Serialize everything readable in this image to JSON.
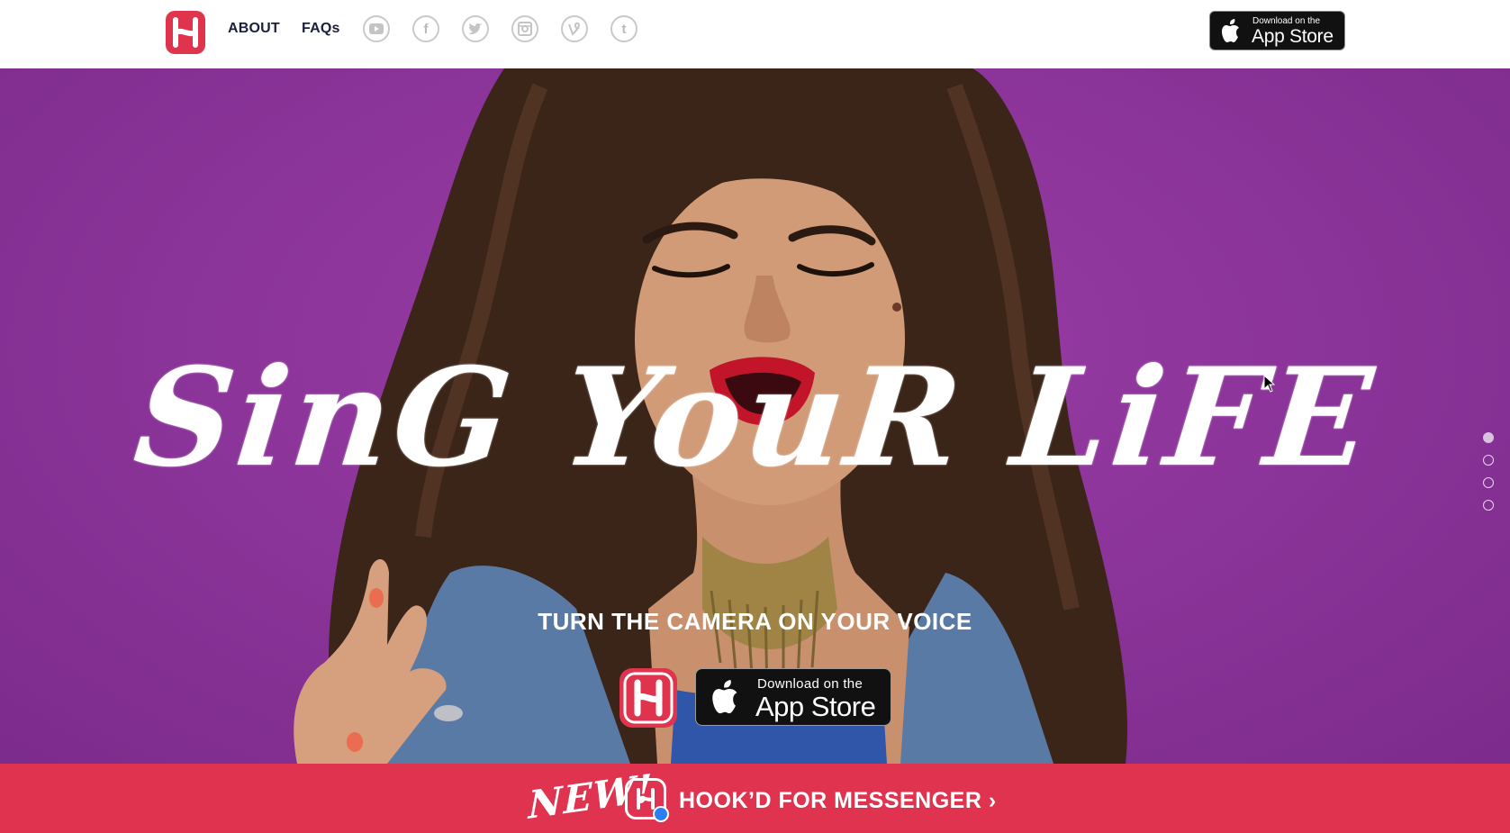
{
  "header": {
    "logo_icon": "hookd-logo-icon",
    "nav": {
      "about_label": "ABOUT",
      "faqs_label": "FAQs"
    },
    "social": [
      {
        "name": "youtube-icon",
        "glyph": "▶"
      },
      {
        "name": "facebook-icon",
        "glyph": "f"
      },
      {
        "name": "twitter-icon",
        "glyph": "t"
      },
      {
        "name": "instagram-icon",
        "glyph": "◘"
      },
      {
        "name": "vine-icon",
        "glyph": "v"
      },
      {
        "name": "tumblr-icon",
        "glyph": "t"
      }
    ],
    "appstore": {
      "line1": "Download on the",
      "line2": "App Store"
    }
  },
  "hero": {
    "headline": "SinG YouR LiFE",
    "subhead": "TURN THE CAMERA ON YOUR VOICE",
    "appstore": {
      "line1": "Download on the",
      "line2": "App Store"
    },
    "slide_dots": 4,
    "active_slide": 1
  },
  "banner": {
    "new_label": "NEW!",
    "text": "HOOK’D FOR MESSENGER ›"
  },
  "colors": {
    "brand_red": "#e0344e",
    "hero_purple": "#8a3398",
    "nav_text": "#1a1f3a"
  }
}
